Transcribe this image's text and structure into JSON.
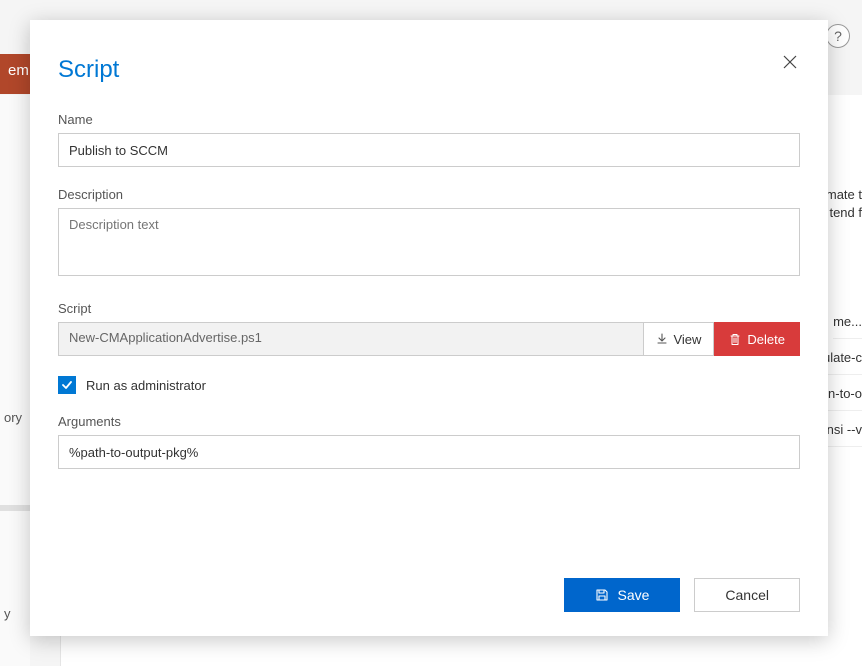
{
  "background": {
    "header_fragment": "em",
    "sidebar": {
      "item1": "ory",
      "item2": "y"
    },
    "right": {
      "text1": "mate t",
      "text2": "tend f",
      "li1": "me...",
      "li2": "ulate-c",
      "li3": "n-to-o",
      "li4": "nsi --v"
    }
  },
  "help": "?",
  "modal": {
    "title": "Script",
    "labels": {
      "name": "Name",
      "description": "Description",
      "script": "Script",
      "arguments": "Arguments"
    },
    "fields": {
      "name_value": "Publish to SCCM",
      "description_placeholder": "Description text",
      "script_filename": "New-CMApplicationAdvertise.ps1",
      "arguments_value": "%path-to-output-pkg%"
    },
    "buttons": {
      "view": "View",
      "delete": "Delete",
      "save": "Save",
      "cancel": "Cancel"
    },
    "checkbox": {
      "run_as_admin": "Run as administrator",
      "checked": true
    }
  }
}
